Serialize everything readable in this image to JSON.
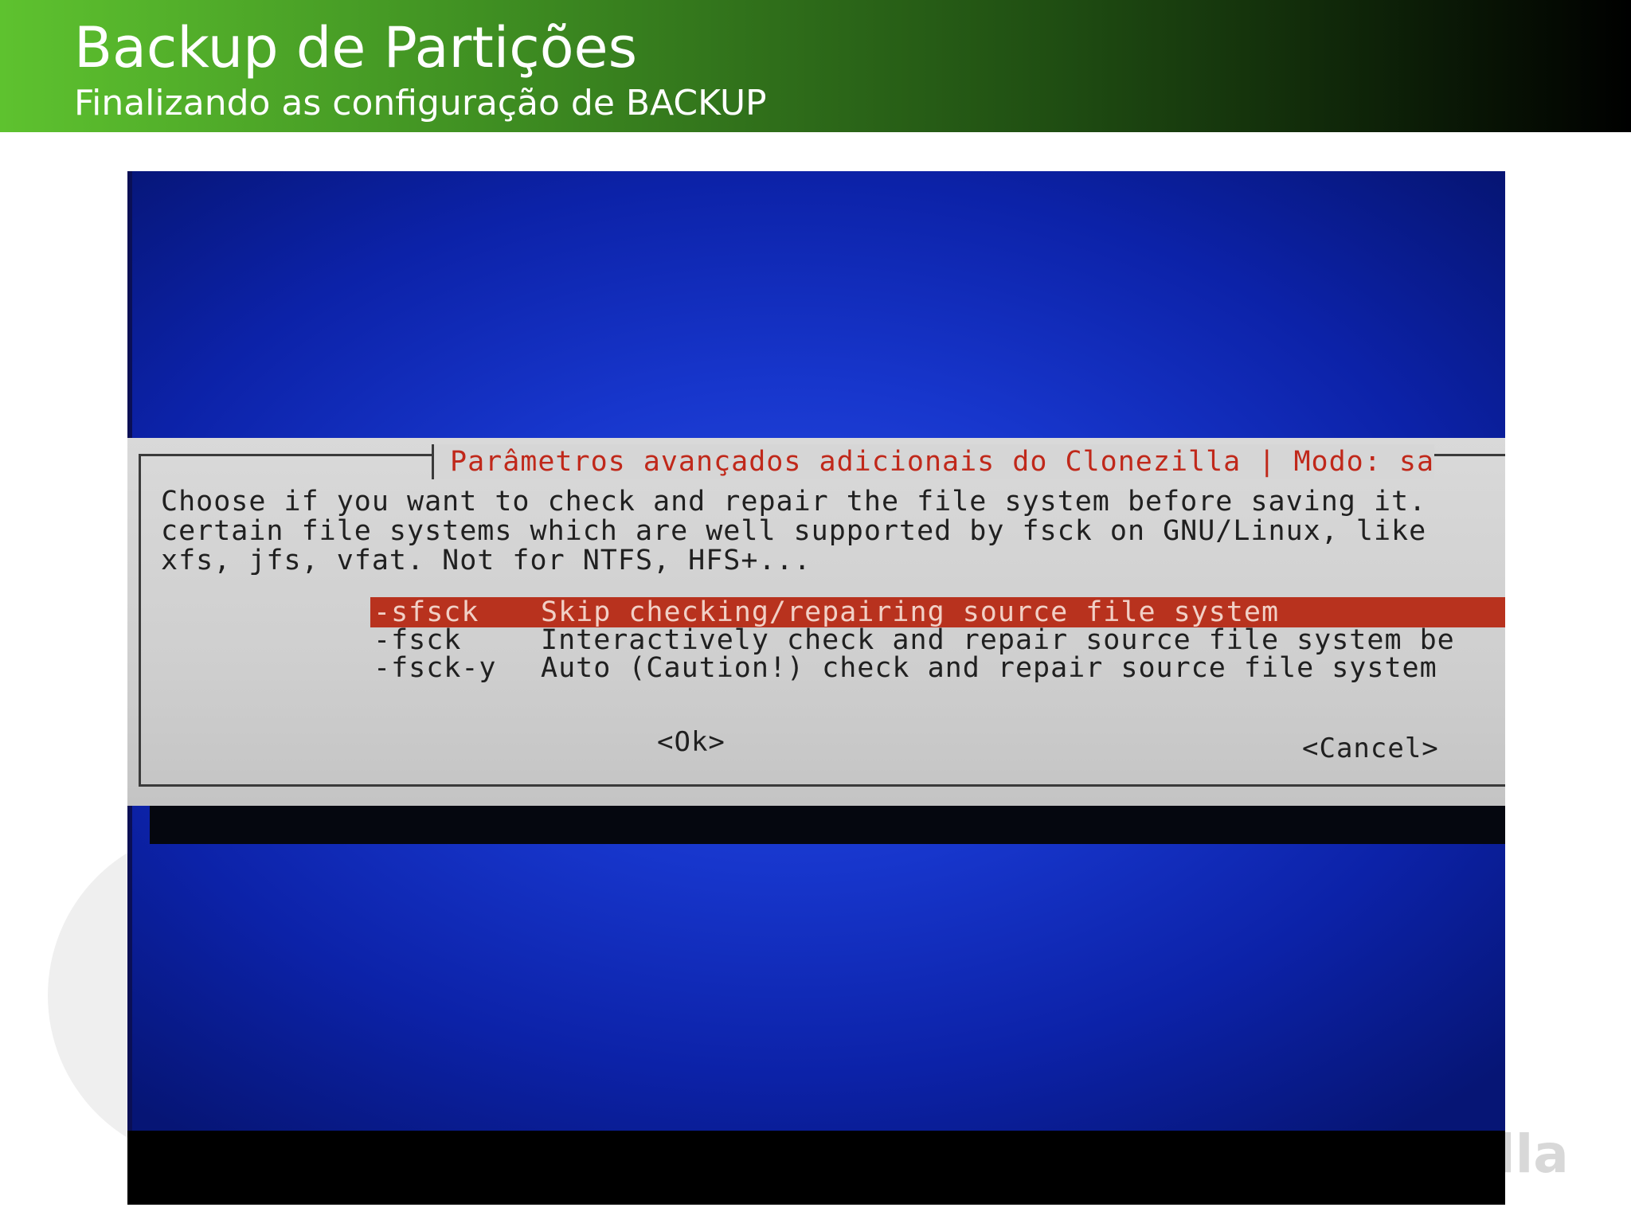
{
  "slide": {
    "title": "Backup de Partições",
    "subtitle": "Finalizando as configuração de BACKUP"
  },
  "watermark": {
    "text": "lla"
  },
  "dialog": {
    "title": "Parâmetros avançados adicionais do Clonezilla | Modo: sa",
    "description": [
      "Choose if you want to check and repair the file system before saving it.",
      "certain file systems which are well supported by fsck on GNU/Linux, like",
      "xfs, jfs, vfat. Not for NTFS, HFS+..."
    ],
    "options": [
      {
        "tag": "-sfsck",
        "label": "Skip checking/repairing source file system",
        "selected": true
      },
      {
        "tag": "-fsck",
        "label": "Interactively check and repair source file system be",
        "selected": false
      },
      {
        "tag": "-fsck-y",
        "label": "Auto (Caution!) check and repair source file system",
        "selected": false
      }
    ],
    "ok_label": "<Ok>",
    "cancel_label": "<Cancel>"
  },
  "colors": {
    "header_start": "#5ec22f",
    "header_end": "#000000",
    "screen_blue": "#1736cc",
    "dialog_gray": "#d6d6d6",
    "title_red": "#c0281a",
    "selection_red": "#b8321e"
  }
}
